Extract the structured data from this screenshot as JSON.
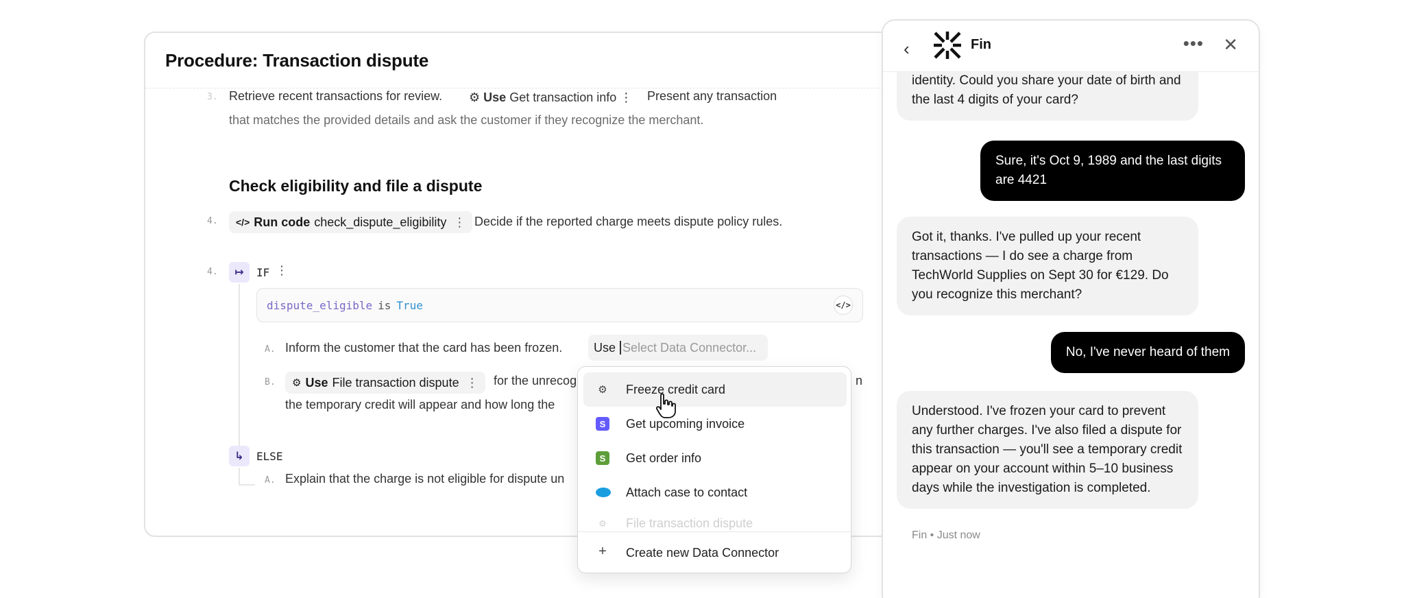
{
  "editor": {
    "title": "Procedure: Transaction dispute",
    "step3": {
      "number": "3.",
      "text_before": "Retrieve recent transactions for review.",
      "use_label": "Use",
      "use_name": "Get transaction info",
      "text_after": "Present any transaction",
      "line2": "that matches the provided details and ask the customer if they recognize the merchant."
    },
    "section_heading": "Check eligibility and file a dispute",
    "step4": {
      "number": "4.",
      "pill_label": "Run code",
      "pill_name": "check_dispute_eligibility",
      "text": "Decide if the reported charge meets dispute policy rules."
    },
    "if_block": {
      "number": "4.",
      "label": "IF",
      "condition": {
        "variable": "dispute_eligible",
        "operator": "is",
        "value": "True"
      },
      "sub_a": {
        "letter": "A.",
        "text": "Inform the customer that the card has been frozen.",
        "use_label": "Use",
        "placeholder": "Select Data Connector..."
      },
      "sub_b": {
        "letter": "B.",
        "pill_label": "Use",
        "pill_name": "File transaction dispute",
        "text_after": "for the unrecog",
        "trailing": "n",
        "line2": "the temporary credit will appear and how long the"
      }
    },
    "else_block": {
      "label": "ELSE",
      "sub_a": {
        "letter": "A.",
        "text": "Explain that the charge is not eligible for dispute un"
      }
    }
  },
  "dropdown": {
    "items": [
      {
        "label": "Freeze credit card",
        "icon": "webhook-icon"
      },
      {
        "label": "Get upcoming invoice",
        "icon": "stripe-icon"
      },
      {
        "label": "Get order info",
        "icon": "shopify-icon"
      },
      {
        "label": "Attach case to contact",
        "icon": "salesforce-icon"
      },
      {
        "label": "File transaction dispute",
        "icon": "webhook-icon"
      }
    ],
    "create_label": "Create new Data Connector"
  },
  "chat": {
    "title": "Fin",
    "messages": [
      {
        "from": "bot",
        "text": "identity. Could you share your date of birth and the last 4 digits of your card?"
      },
      {
        "from": "user",
        "text": "Sure, it's Oct 9, 1989 and the last digits are 4421"
      },
      {
        "from": "bot",
        "text": "Got it, thanks. I've pulled up your recent transactions — I do see a charge from TechWorld Supplies on Sept 30 for €129. Do you recognize this merchant?"
      },
      {
        "from": "user",
        "text": "No, I've never heard of them"
      },
      {
        "from": "bot",
        "text": "Understood. I've frozen your card to prevent any further charges. I've also filed a dispute for this transaction — you'll see a temporary credit appear on your account within 5–10 business days while the investigation is completed."
      }
    ],
    "meta": "Fin • Just now"
  },
  "colors": {
    "accent_purple": "#7a67c7",
    "code_value_blue": "#2f8fd0",
    "badge_bg": "#ece8fb"
  }
}
